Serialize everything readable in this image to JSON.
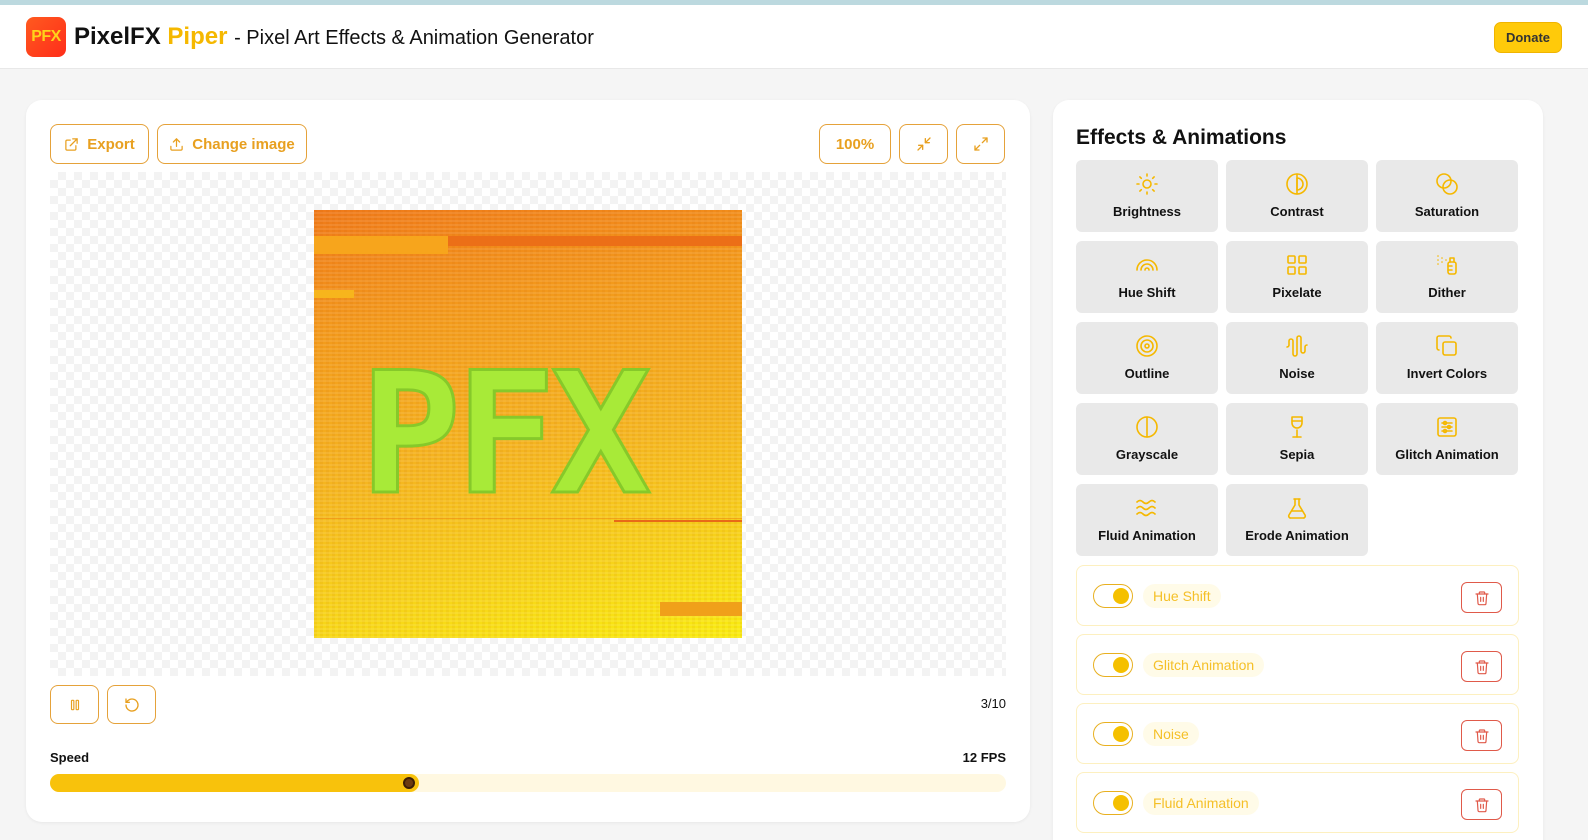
{
  "app": {
    "logo_text": "PFX",
    "name": "PixelFX",
    "name_accent": "Piper",
    "tagline": "- Pixel Art Effects & Animation Generator",
    "donate_label": "Donate"
  },
  "toolbar": {
    "export_label": "Export",
    "change_image_label": "Change image",
    "zoom_label": "100%"
  },
  "canvas": {
    "art_text": "PFX"
  },
  "playback": {
    "frame_counter": "3/10",
    "speed_label": "Speed",
    "fps_label": "12 FPS",
    "speed_fraction": 0.38
  },
  "effects": {
    "title": "Effects & Animations",
    "items": [
      {
        "label": "Brightness",
        "icon": "sun-icon"
      },
      {
        "label": "Contrast",
        "icon": "contrast-icon"
      },
      {
        "label": "Saturation",
        "icon": "circles-icon"
      },
      {
        "label": "Hue Shift",
        "icon": "rainbow-icon"
      },
      {
        "label": "Pixelate",
        "icon": "grid-icon"
      },
      {
        "label": "Dither",
        "icon": "spray-icon"
      },
      {
        "label": "Outline",
        "icon": "target-icon"
      },
      {
        "label": "Noise",
        "icon": "waveform-icon"
      },
      {
        "label": "Invert Colors",
        "icon": "layers-icon"
      },
      {
        "label": "Grayscale",
        "icon": "half-circle-icon"
      },
      {
        "label": "Sepia",
        "icon": "glass-icon"
      },
      {
        "label": "Glitch Animation",
        "icon": "sliders-icon"
      },
      {
        "label": "Fluid Animation",
        "icon": "waves-icon"
      },
      {
        "label": "Erode Animation",
        "icon": "flask-icon"
      }
    ]
  },
  "layers": [
    {
      "label": "Hue Shift",
      "enabled": true
    },
    {
      "label": "Glitch Animation",
      "enabled": true
    },
    {
      "label": "Noise",
      "enabled": true
    },
    {
      "label": "Fluid Animation",
      "enabled": true
    }
  ],
  "colors": {
    "accent": "#f5b800",
    "button_border": "#e5a23a",
    "danger": "#e05a4a"
  }
}
